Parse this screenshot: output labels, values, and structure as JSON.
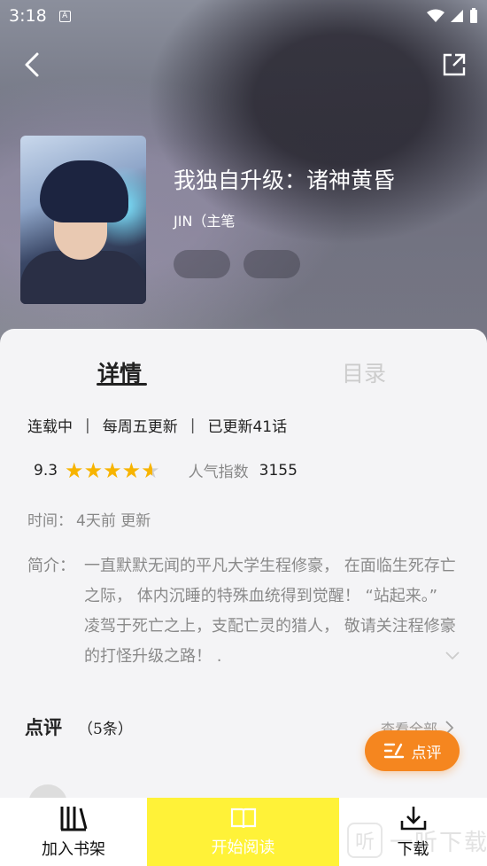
{
  "status": {
    "time": "3:18",
    "a_icon": "A"
  },
  "book": {
    "title": "我独自升级：诸神黄昏",
    "author": "JIN（主笔",
    "tags": [
      "",
      ""
    ]
  },
  "tabs": {
    "details": "详情",
    "toc": "目录"
  },
  "meta": {
    "status": "连载中",
    "schedule": "每周五更新",
    "updated": "已更新41话",
    "sep": "|"
  },
  "rating": {
    "score": "9.3",
    "stars": 4.5,
    "popularity_label": "人气指数",
    "popularity_value": "3155"
  },
  "time": {
    "label": "时间：",
    "value": "4天前 更新"
  },
  "intro": {
    "label": "简介：",
    "text": "一直默默无闻的平凡大学生程修豪， 在面临生死存亡之际， 体内沉睡的特殊血统得到觉醒！ “站起来。” 凌驾于死亡之上，支配亡灵的猎人， 敬请关注程修豪的打怪升级之路！ ."
  },
  "reviews": {
    "title": "点评",
    "count": "（5条）",
    "view_all": "查看全部",
    "comment_button": "点评"
  },
  "bottom": {
    "shelf": "加入书架",
    "read": "开始阅读",
    "download": "下载"
  },
  "watermark": {
    "icon": "听",
    "text": "一听下载"
  },
  "colors": {
    "accent_yellow": "#fff238",
    "comment_orange": "#f5861f",
    "star": "#f7b400"
  }
}
